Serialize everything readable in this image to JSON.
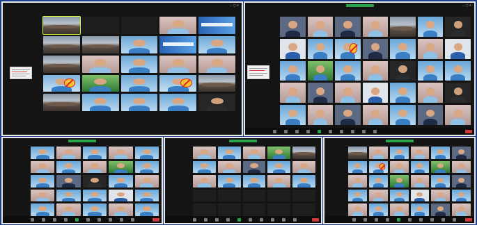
{
  "windows": [
    {
      "id": "w1",
      "title": "",
      "cols": 5,
      "rows": 6,
      "tileH": 24,
      "tiles": [
        "room",
        "text",
        "text",
        "pink",
        "banner",
        "room",
        "room",
        "blue",
        "banner",
        "blue",
        "room",
        "pink",
        "blue",
        "pink",
        "pink",
        "sign",
        "green",
        "blue",
        "sign",
        "room",
        "room",
        "blue",
        "blue",
        "blue",
        "dark",
        "",
        "",
        "",
        "",
        ""
      ],
      "tileLabels": {
        "1": "",
        "2": ""
      },
      "selected": 0,
      "hasSidecard": true
    },
    {
      "id": "w2",
      "title": "",
      "cols": 7,
      "rows": 5,
      "tileH": 22,
      "tiles": [
        "mono",
        "pink",
        "mono",
        "pink",
        "room",
        "blue",
        "dark",
        "white",
        "blue",
        "sign",
        "mono",
        "blue",
        "pink",
        "white",
        "blue",
        "green",
        "blue",
        "pink",
        "dark",
        "blue",
        "blue",
        "pink",
        "mono",
        "pink",
        "white",
        "blue",
        "pink",
        "dark",
        "blue",
        "pink",
        "mono",
        "pink",
        "blue",
        "mono",
        "pink"
      ],
      "hasSidecard": true
    },
    {
      "id": "w3",
      "title": "",
      "cols": 5,
      "rows": 5,
      "tileH": 14,
      "tiles": [
        "blue",
        "pink",
        "blue",
        "pink",
        "blue",
        "pink",
        "blue",
        "pink",
        "green",
        "blue",
        "blue",
        "mono",
        "dark",
        "blue",
        "pink",
        "pink",
        "blue",
        "blue",
        "white",
        "blue",
        "blue",
        "pink",
        "blue",
        "pink",
        "blue"
      ]
    },
    {
      "id": "w4",
      "title": "",
      "cols": 5,
      "rows": 5,
      "tileH": 13,
      "tiles": [
        "pink",
        "blue",
        "pink",
        "green",
        "room",
        "blue",
        "pink",
        "mono",
        "blue",
        "pink",
        "pink",
        "blue",
        "blue",
        "pink",
        "blue",
        "text",
        "text",
        "text",
        "text",
        "text",
        "text",
        "text",
        "text",
        "text",
        "text"
      ]
    },
    {
      "id": "w5",
      "title": "",
      "cols": 6,
      "rows": 5,
      "tileH": 13,
      "tiles": [
        "room",
        "pink",
        "blue",
        "pink",
        "blue",
        "mono",
        "blue",
        "sign",
        "pink",
        "blue",
        "green",
        "pink",
        "pink",
        "blue",
        "green",
        "pink",
        "blue",
        "mono",
        "blue",
        "pink",
        "blue",
        "white",
        "pink",
        "blue",
        "pink",
        "blue",
        "pink",
        "blue",
        "mono",
        "pink"
      ]
    }
  ],
  "colors": {
    "desktop": "#1d3f8c",
    "window_bg": "#141414",
    "share_bar": "#2aa44b",
    "end_button": "#d13a3a"
  },
  "icons": {
    "window_controls": "window-controls-icon",
    "end_meeting": "end-meeting-icon",
    "share": "screen-share-icon"
  }
}
